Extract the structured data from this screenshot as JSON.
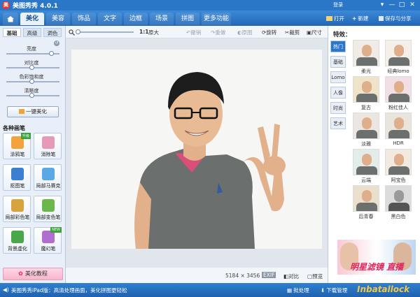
{
  "titlebar": {
    "logo_glyph": "美",
    "title": "美图秀秀 4.0.1",
    "login": "登录",
    "window_buttons": [
      "▾",
      "—",
      "□",
      "✕"
    ]
  },
  "nav": {
    "home_icon": "home-icon",
    "tabs": [
      "美化",
      "美容",
      "饰品",
      "文字",
      "边框",
      "场景",
      "拼图",
      "更多功能 ▾"
    ],
    "active_tab": "美化",
    "open": "打开",
    "new": "新建",
    "save_share": "保存与分享"
  },
  "left": {
    "subtabs": [
      "基础",
      "高级",
      "调色"
    ],
    "sliders": [
      {
        "label": "亮度",
        "value": 0.84
      },
      {
        "label": "对比度",
        "value": 0.48
      },
      {
        "label": "色彩饱和度",
        "value": 0.48
      },
      {
        "label": "清晰度",
        "value": 0.48
      }
    ],
    "one_key": "一键美化",
    "section_title": "各种画笔",
    "tools": [
      {
        "label": "涂鸦笔",
        "color": "#f2a33c",
        "badge": "升级"
      },
      {
        "label": "消除笔",
        "color": "#e59ab5",
        "badge": ""
      },
      {
        "label": "抠图笔",
        "color": "#3a7fd0",
        "badge": ""
      },
      {
        "label": "局部马赛克",
        "color": "#5aa9e6",
        "badge": ""
      },
      {
        "label": "局部彩色笔",
        "color": "#d9a33c",
        "badge": ""
      },
      {
        "label": "局部变色笔",
        "color": "#6bb84a",
        "badge": ""
      },
      {
        "label": "背景虚化",
        "color": "#4aa64a",
        "badge": ""
      },
      {
        "label": "魔幻笔",
        "color": "#b06fd0",
        "badge": "NEW"
      }
    ],
    "tutorial": "美化教程"
  },
  "toolbar": {
    "zoom_ratio": "1:1",
    "original_size": "原大",
    "undo": "撤销",
    "redo": "重做",
    "original": "原图",
    "rotate": "旋转",
    "crop": "裁剪",
    "size": "尺寸"
  },
  "canvas": {
    "dimensions": "5184 × 3456",
    "exif": "EXIF",
    "compare": "对比",
    "preview": "预览"
  },
  "right": {
    "title": "特效：",
    "categories": [
      "热门",
      "基础",
      "Lomo",
      "人像",
      "时尚",
      "艺术"
    ],
    "active_category": "热门",
    "effects": [
      "柔光",
      "经典lomo",
      "复古",
      "粉红佳人",
      "淡雅",
      "HDR",
      "云端",
      "阿宝色",
      "后青春",
      "黑白色"
    ],
    "ad_text": "明星滤镜 直播"
  },
  "bottom": {
    "message": "美图秀秀iPad版：高清处理画面，美化拼图更轻松",
    "batch": "批处理",
    "download": "下载管理",
    "watermark": "Inbatallock"
  }
}
